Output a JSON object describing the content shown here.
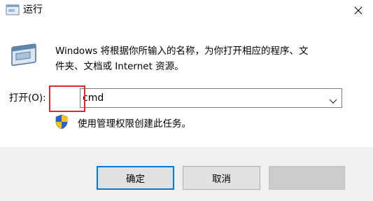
{
  "window": {
    "title": "运行",
    "icon": "run-app-icon",
    "close_icon": "close-icon"
  },
  "main": {
    "icon": "run-app-icon",
    "description_line1": "Windows 将根据你所输入的名称，为你打开相应的程序、文",
    "description_line2": "件夹、文档或 Internet 资源。"
  },
  "open_field": {
    "label": "打开(O):",
    "value": "cmd",
    "highlight_color": "#e2262c"
  },
  "admin_notice": {
    "icon": "uac-shield-icon",
    "text": "使用管理权限创建此任务。"
  },
  "buttons": {
    "ok": "确定",
    "cancel": "取消",
    "browse": ""
  },
  "colors": {
    "accent": "#0078d7",
    "dialog_bg": "#f0f0f0",
    "content_bg": "#ffffff"
  }
}
